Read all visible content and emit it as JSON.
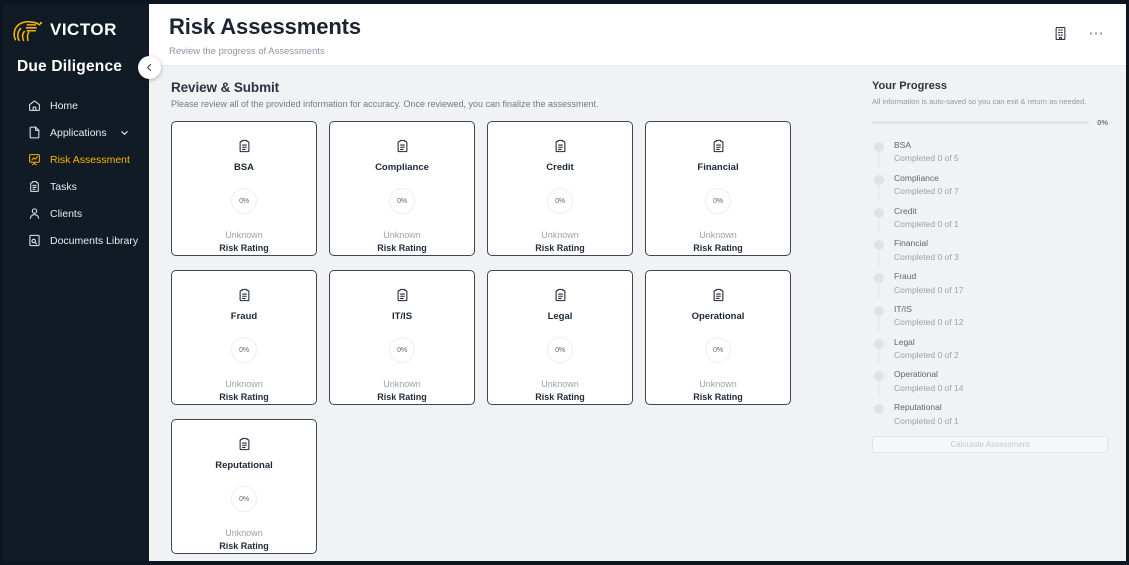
{
  "brand": {
    "logo_icon": "victor-lion-logo-icon",
    "wordmark": "VICTOR",
    "accent_color": "#f5b400",
    "app_name": "Due Diligence"
  },
  "sidebar": {
    "collapse_icon": "chevron-left-icon",
    "items": [
      {
        "label": "Home",
        "icon": "home-icon",
        "active": false,
        "expandable": false
      },
      {
        "label": "Applications",
        "icon": "document-icon",
        "active": false,
        "expandable": true
      },
      {
        "label": "Risk Assessment",
        "icon": "chart-board-icon",
        "active": true,
        "expandable": false
      },
      {
        "label": "Tasks",
        "icon": "clipboard-icon",
        "active": false,
        "expandable": false
      },
      {
        "label": "Clients",
        "icon": "user-icon",
        "active": false,
        "expandable": false
      },
      {
        "label": "Documents Library",
        "icon": "document-search-icon",
        "active": false,
        "expandable": false
      }
    ]
  },
  "header": {
    "title": "Risk Assessments",
    "subtitle": "Review the progress of Assessments",
    "building_icon": "building-icon",
    "more_icon": "more-horizontal-icon"
  },
  "review": {
    "title": "Review & Submit",
    "subtitle": "Please review all of the provided information for accuracy. Once reviewed, you can finalize the assessment.",
    "rating_label": "Risk Rating",
    "card_icon": "clipboard-icon",
    "cards": [
      {
        "title": "BSA",
        "percent": "0%",
        "rating": "Unknown",
        "rating_label": "Risk Rating"
      },
      {
        "title": "Compliance",
        "percent": "0%",
        "rating": "Unknown",
        "rating_label": "Risk Rating"
      },
      {
        "title": "Credit",
        "percent": "0%",
        "rating": "Unknown",
        "rating_label": "Risk Rating"
      },
      {
        "title": "Financial",
        "percent": "0%",
        "rating": "Unknown",
        "rating_label": "Risk Rating"
      },
      {
        "title": "Fraud",
        "percent": "0%",
        "rating": "Unknown",
        "rating_label": "Risk Rating"
      },
      {
        "title": "IT/IS",
        "percent": "0%",
        "rating": "Unknown",
        "rating_label": "Risk Rating"
      },
      {
        "title": "Legal",
        "percent": "0%",
        "rating": "Unknown",
        "rating_label": "Risk Rating"
      },
      {
        "title": "Operational",
        "percent": "0%",
        "rating": "Unknown",
        "rating_label": "Risk Rating"
      },
      {
        "title": "Reputational",
        "percent": "0%",
        "rating": "Unknown",
        "rating_label": "Risk Rating"
      }
    ]
  },
  "progress_panel": {
    "title": "Your Progress",
    "subtitle": "All information is auto-saved so you can exit & return as needed.",
    "overall_percent": "0%",
    "overall_value": 0,
    "calculate_button": "Calculate Assessment",
    "calculate_disabled": true,
    "steps": [
      {
        "name": "BSA",
        "meta": "Completed 0 of 5"
      },
      {
        "name": "Compliance",
        "meta": "Completed 0 of 7"
      },
      {
        "name": "Credit",
        "meta": "Completed 0 of 1"
      },
      {
        "name": "Financial",
        "meta": "Completed 0 of 3"
      },
      {
        "name": "Fraud",
        "meta": "Completed 0 of 17"
      },
      {
        "name": "IT/IS",
        "meta": "Completed 0 of 12"
      },
      {
        "name": "Legal",
        "meta": "Completed 0 of 2"
      },
      {
        "name": "Operational",
        "meta": "Completed 0 of 14"
      },
      {
        "name": "Reputational",
        "meta": "Completed 0 of 1"
      }
    ]
  }
}
